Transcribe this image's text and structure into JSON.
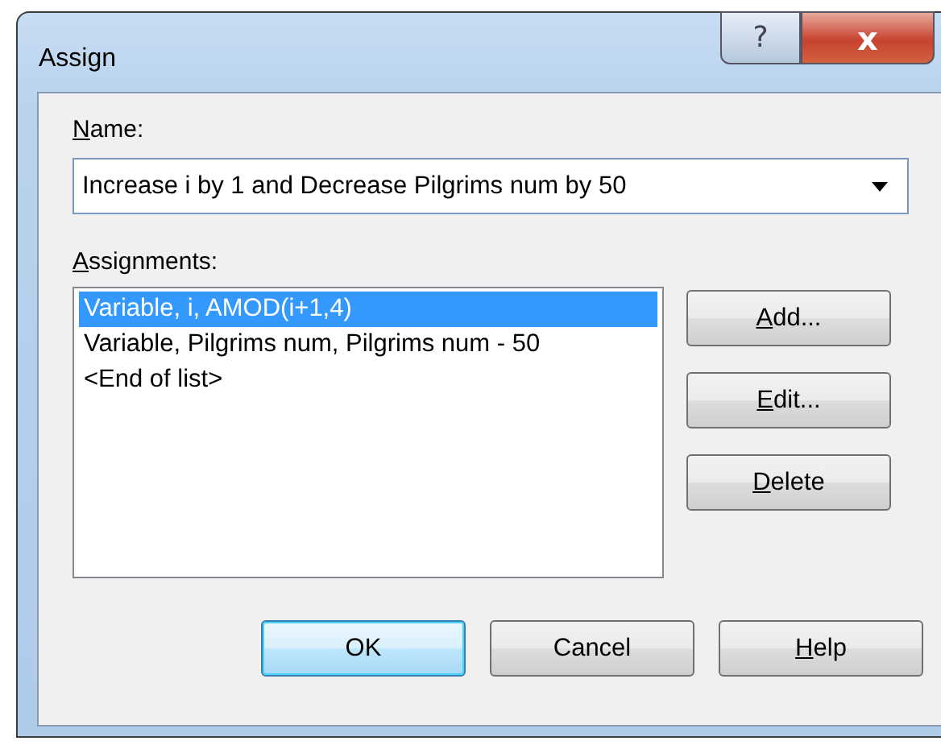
{
  "window": {
    "title": "Assign",
    "caption_buttons": [
      {
        "kind": "help",
        "label": "?"
      },
      {
        "kind": "close",
        "label": "x"
      }
    ]
  },
  "name_field": {
    "key": "N",
    "rest": "ame:",
    "value": "Increase i by 1 and Decrease Pilgrims num by 50"
  },
  "assignments": {
    "key": "A",
    "rest": "ssignments:",
    "items": [
      {
        "text": "Variable, i, AMOD(i+1,4)",
        "selected": true
      },
      {
        "text": "Variable, Pilgrims num, Pilgrims num - 50",
        "selected": false
      },
      {
        "text": "<End of list>",
        "selected": false
      }
    ]
  },
  "side_buttons": [
    {
      "key": "A",
      "rest": "dd..."
    },
    {
      "key": "E",
      "rest": "dit..."
    },
    {
      "key": "D",
      "rest": "elete"
    }
  ],
  "bottom_buttons": [
    {
      "rest": "OK",
      "default": true
    },
    {
      "rest": "Cancel",
      "default": false
    },
    {
      "key": "H",
      "rest": "elp",
      "default": false
    }
  ]
}
